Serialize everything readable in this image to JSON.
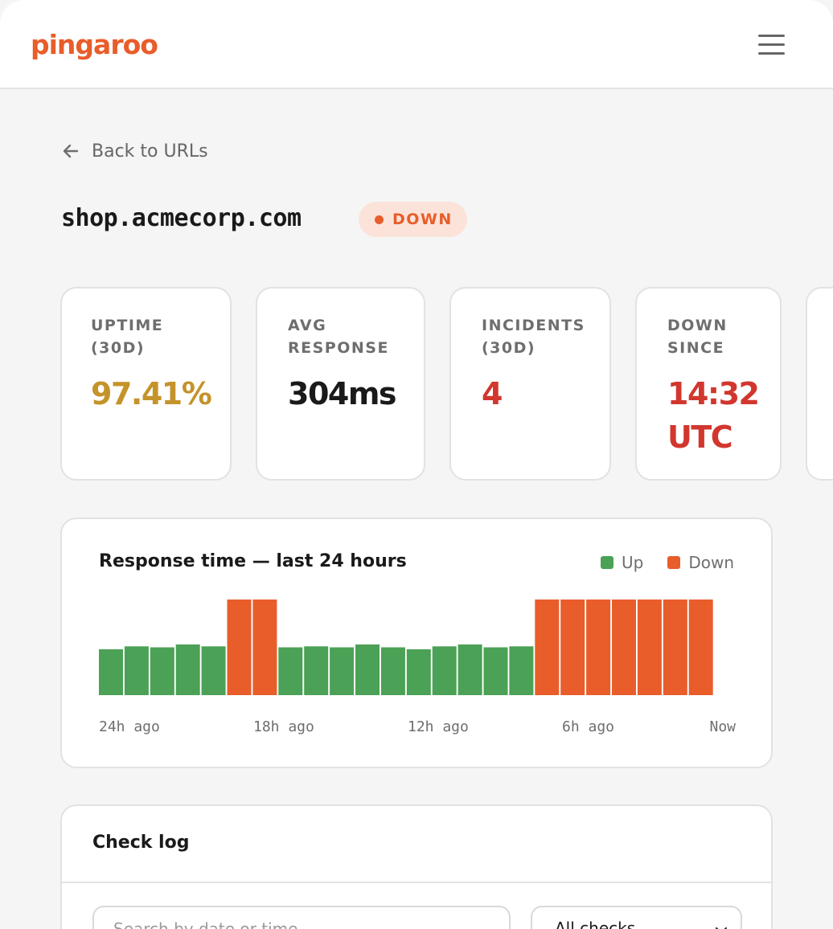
{
  "brand": {
    "name": "pingaroo",
    "color": "#e85d2a"
  },
  "nav": {
    "back_label": "Back to URLs"
  },
  "monitor": {
    "url": "shop.acmecorp.com",
    "status_label": "DOWN",
    "status_color": "#e85d2a"
  },
  "stats": [
    {
      "label": "UPTIME\n(30D)",
      "value": "97.41%",
      "color": "#c4932a"
    },
    {
      "label": "AVG\nRESPONSE",
      "value": "304ms",
      "color": "#1a1a1a"
    },
    {
      "label": "INCIDENTS\n(30D)",
      "value": "4",
      "color": "#d1372e"
    },
    {
      "label": "DOWN\nSINCE",
      "value": "14:32 UTC",
      "color": "#d1372e"
    }
  ],
  "chart": {
    "title": "Response time — last 24 hours",
    "legend": [
      {
        "label": "Up",
        "color": "#4ba155"
      },
      {
        "label": "Down",
        "color": "#e85d2a"
      }
    ]
  },
  "chart_data": {
    "type": "bar",
    "title": "Response time — last 24 hours",
    "xlabel": "",
    "ylabel": "",
    "x_tick_labels": [
      "24h ago",
      "18h ago",
      "12h ago",
      "6h ago",
      "Now"
    ],
    "ylim": [
      0,
      100
    ],
    "series": [
      {
        "name": "Up",
        "color": "#4ba155"
      },
      {
        "name": "Down",
        "color": "#e85d2a"
      }
    ],
    "bars": [
      {
        "value": 48,
        "status": "Up"
      },
      {
        "value": 51,
        "status": "Up"
      },
      {
        "value": 50,
        "status": "Up"
      },
      {
        "value": 53,
        "status": "Up"
      },
      {
        "value": 51,
        "status": "Up"
      },
      {
        "value": 100,
        "status": "Down"
      },
      {
        "value": 100,
        "status": "Down"
      },
      {
        "value": 50,
        "status": "Up"
      },
      {
        "value": 51,
        "status": "Up"
      },
      {
        "value": 50,
        "status": "Up"
      },
      {
        "value": 53,
        "status": "Up"
      },
      {
        "value": 50,
        "status": "Up"
      },
      {
        "value": 48,
        "status": "Up"
      },
      {
        "value": 51,
        "status": "Up"
      },
      {
        "value": 53,
        "status": "Up"
      },
      {
        "value": 50,
        "status": "Up"
      },
      {
        "value": 51,
        "status": "Up"
      },
      {
        "value": 100,
        "status": "Down"
      },
      {
        "value": 100,
        "status": "Down"
      },
      {
        "value": 100,
        "status": "Down"
      },
      {
        "value": 100,
        "status": "Down"
      },
      {
        "value": 100,
        "status": "Down"
      },
      {
        "value": 100,
        "status": "Down"
      },
      {
        "value": 100,
        "status": "Down"
      }
    ]
  },
  "check_log": {
    "title": "Check log",
    "search_placeholder": "Search by date or time",
    "filter_selected": "All checks"
  }
}
